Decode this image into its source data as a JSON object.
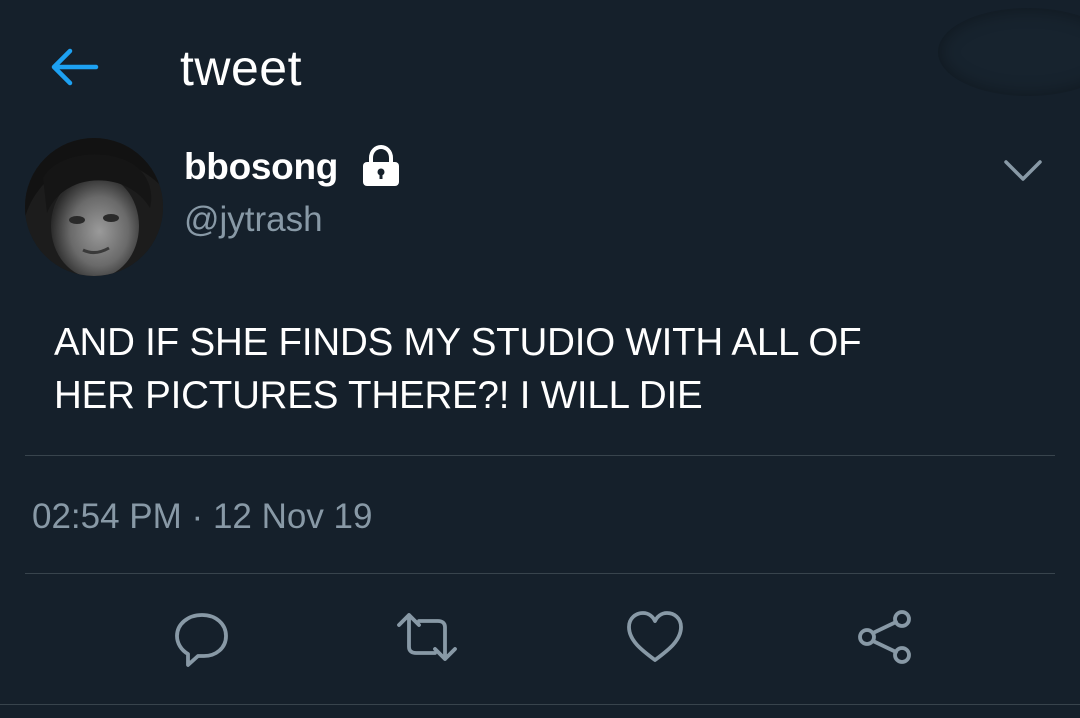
{
  "header": {
    "title": "tweet",
    "back_icon": "arrow-left-icon"
  },
  "tweet": {
    "author_name": "bbosong",
    "author_handle": "@jytrash",
    "protected_icon": "lock-icon",
    "text": "AND IF SHE FINDS MY STUDIO WITH ALL OF\nHER PICTURES THERE?! I WILL DIE",
    "time": "02:54 PM",
    "separator": "·",
    "date": "12 Nov 19"
  },
  "actions": [
    {
      "name": "reply",
      "icon": "reply-icon"
    },
    {
      "name": "retweet",
      "icon": "retweet-icon"
    },
    {
      "name": "like",
      "icon": "heart-icon"
    },
    {
      "name": "share",
      "icon": "share-icon"
    }
  ],
  "colors": {
    "background": "#15202b",
    "accent": "#1da1f2",
    "secondary_text": "#8899a6",
    "divider": "#38444d"
  }
}
